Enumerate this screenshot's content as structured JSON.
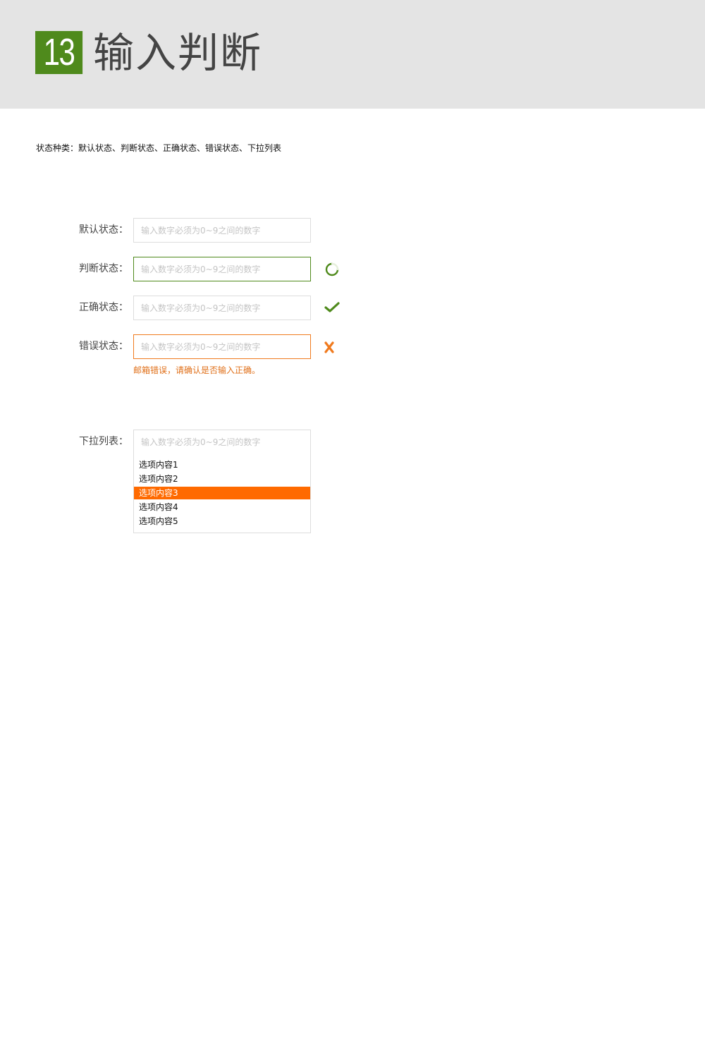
{
  "header": {
    "number": "13",
    "title": "输入判断"
  },
  "intro": "状态种类：默认状态、判断状态、正确状态、错误状态、下拉列表",
  "placeholder": "输入数字必须为0~9之间的数字",
  "rows": {
    "default": {
      "label": "默认状态："
    },
    "judging": {
      "label": "判断状态：",
      "icon": "loading-spinner-icon"
    },
    "correct": {
      "label": "正确状态：",
      "icon": "check-icon"
    },
    "error": {
      "label": "错误状态：",
      "icon": "cross-icon",
      "message": "邮箱错误，请确认是否输入正确。"
    }
  },
  "dropdown": {
    "label": "下拉列表：",
    "options": [
      "选项内容1",
      "选项内容2",
      "选项内容3",
      "选项内容4",
      "选项内容5"
    ],
    "selected_index": 2
  },
  "colors": {
    "accent_green": "#4f8a1c",
    "error_orange": "#f07a1e",
    "selected_orange": "#ff6a00",
    "header_bg": "#e4e4e4"
  }
}
